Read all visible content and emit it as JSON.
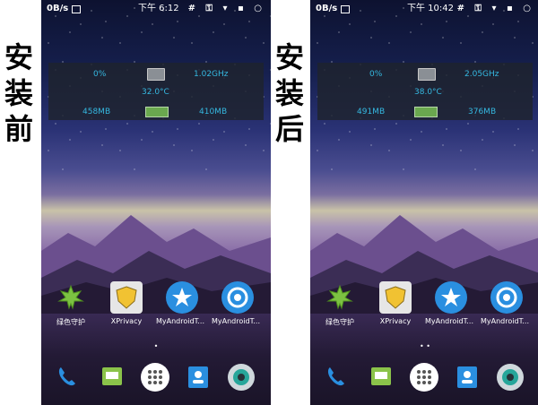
{
  "panels": [
    {
      "side_label": [
        "安",
        "装",
        "前"
      ],
      "status": {
        "speed": "0B/s",
        "time": "下午 6:12",
        "icons": "# ⚿ ▾ ▪ ○"
      },
      "widget": {
        "cpu": "0%",
        "freq": "1.02GHz",
        "temp": "32.0°C",
        "mem_used": "458MB",
        "mem_free": "410MB"
      },
      "apps": [
        "绿色守护",
        "XPrivacy",
        "MyAndroidToo…",
        "MyAndroidToo…"
      ]
    },
    {
      "side_label": [
        "安",
        "装",
        "后"
      ],
      "status": {
        "speed": "0B/s",
        "time": "下午 10:42",
        "icons": "# ⚿ ▾ ▪ ○"
      },
      "widget": {
        "cpu": "0%",
        "freq": "2.05GHz",
        "temp": "38.0°C",
        "mem_used": "491MB",
        "mem_free": "376MB"
      },
      "apps": [
        "绿色守护",
        "XPrivacy",
        "MyAndroidToo…",
        "MyAndroidToo…"
      ]
    }
  ],
  "page_dots": [
    "•",
    "• •"
  ],
  "colors": {
    "widget_text": "#35b8e0",
    "accent_blue": "#2a8fe0"
  }
}
